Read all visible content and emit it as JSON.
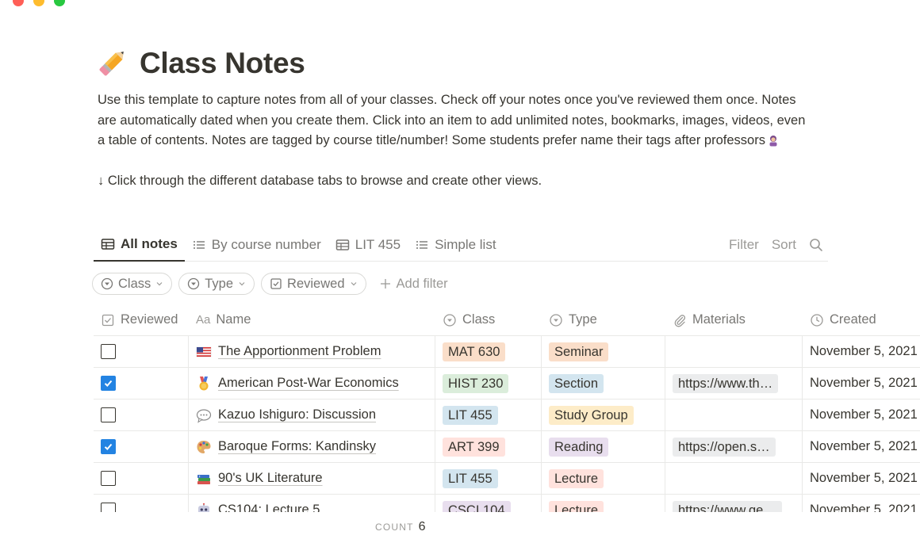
{
  "window": {
    "controls": [
      "close",
      "minimize",
      "zoom"
    ],
    "control_colors": [
      "#ff5f57",
      "#febc2e",
      "#28c840"
    ]
  },
  "page": {
    "emoji": "pencil-icon",
    "title": "Class Notes",
    "description": [
      "Use this template to capture notes from all of your classes. Check off your notes once you've reviewed them once. Notes are automatically dated when you create them. Click into an item to add unlimited notes, bookmarks, images, videos, even a table of contents. Notes are tagged by course title/number!  Some students prefer name their tags after professors",
      "↓ Click through the different database tabs to browse and create other views."
    ]
  },
  "tabs": [
    {
      "label": "All notes",
      "icon": "table-icon",
      "active": true
    },
    {
      "label": "By course number",
      "icon": "list-icon",
      "active": false
    },
    {
      "label": "LIT 455",
      "icon": "table-icon",
      "active": false
    },
    {
      "label": "Simple list",
      "icon": "list-icon",
      "active": false
    }
  ],
  "toolbar": {
    "filter_label": "Filter",
    "sort_label": "Sort"
  },
  "filters": [
    {
      "label": "Class",
      "icon": "select-icon"
    },
    {
      "label": "Type",
      "icon": "select-icon"
    },
    {
      "label": "Reviewed",
      "icon": "checkbox-icon"
    }
  ],
  "add_filter_label": "Add filter",
  "columns": {
    "reviewed": "Reviewed",
    "name_prefix": "Aa",
    "name": "Name",
    "class": "Class",
    "type": "Type",
    "materials": "Materials",
    "created": "Created"
  },
  "tag_colors": {
    "orange": "#fadec9",
    "green": "#dbeddb",
    "blue": "#d3e5ef",
    "yellow": "#fdecc8",
    "purple": "#e8deee",
    "red": "#ffe2dd",
    "brown": "#eee0da"
  },
  "rows": [
    {
      "reviewed": false,
      "emoji": "us-flag-icon",
      "name": "The Apportionment Problem",
      "class": "MAT 630",
      "class_color": "#fadec9",
      "type": "Seminar",
      "type_color": "#fadec9",
      "materials": "",
      "created": "November 5, 2021"
    },
    {
      "reviewed": true,
      "emoji": "medal-icon",
      "name": "American Post-War Economics",
      "class": "HIST 230",
      "class_color": "#dbeddb",
      "type": "Section",
      "type_color": "#d3e5ef",
      "materials": "https://www.th…",
      "created": "November 5, 2021"
    },
    {
      "reviewed": false,
      "emoji": "speech-bubble-icon",
      "name": "Kazuo Ishiguro: Discussion",
      "class": "LIT 455",
      "class_color": "#d3e5ef",
      "type": "Study Group",
      "type_color": "#fdecc8",
      "materials": "",
      "created": "November 5, 2021"
    },
    {
      "reviewed": true,
      "emoji": "palette-icon",
      "name": "Baroque Forms: Kandinsky",
      "class": "ART 399",
      "class_color": "#ffe2dd",
      "type": "Reading",
      "type_color": "#e8deee",
      "materials": "https://open.s…",
      "created": "November 5, 2021"
    },
    {
      "reviewed": false,
      "emoji": "books-icon",
      "name": "90's UK Literature",
      "class": "LIT 455",
      "class_color": "#d3e5ef",
      "type": "Lecture",
      "type_color": "#ffe2dd",
      "materials": "",
      "created": "November 5, 2021"
    },
    {
      "reviewed": false,
      "emoji": "robot-icon",
      "name": "CS104: Lecture 5",
      "class": "CSCI 104",
      "class_color": "#e8deee",
      "type": "Lecture",
      "type_color": "#ffe2dd",
      "materials": "https://www.ge…",
      "created": "November 5, 2021"
    }
  ],
  "footer": {
    "count_label": "COUNT",
    "count_value": "6"
  }
}
